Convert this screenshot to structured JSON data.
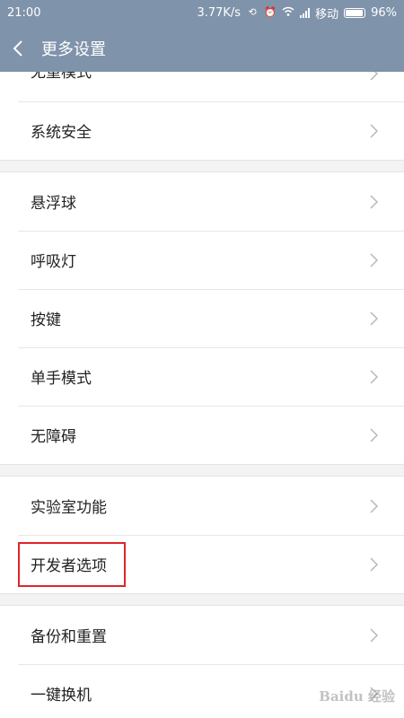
{
  "status_bar": {
    "time": "21:00",
    "network_speed": "3.77K/s",
    "carrier": "移动",
    "battery": "96%"
  },
  "header": {
    "title": "更多设置"
  },
  "groups": [
    {
      "rows": [
        "无重模式",
        "系统安全"
      ]
    },
    {
      "rows": [
        "悬浮球",
        "呼吸灯",
        "按键",
        "单手模式",
        "无障碍"
      ]
    },
    {
      "rows": [
        "实验室功能",
        "开发者选项"
      ]
    },
    {
      "rows": [
        "备份和重置",
        "一键换机"
      ]
    }
  ],
  "highlighted_item": "开发者选项",
  "watermark": "Baidu 经验"
}
